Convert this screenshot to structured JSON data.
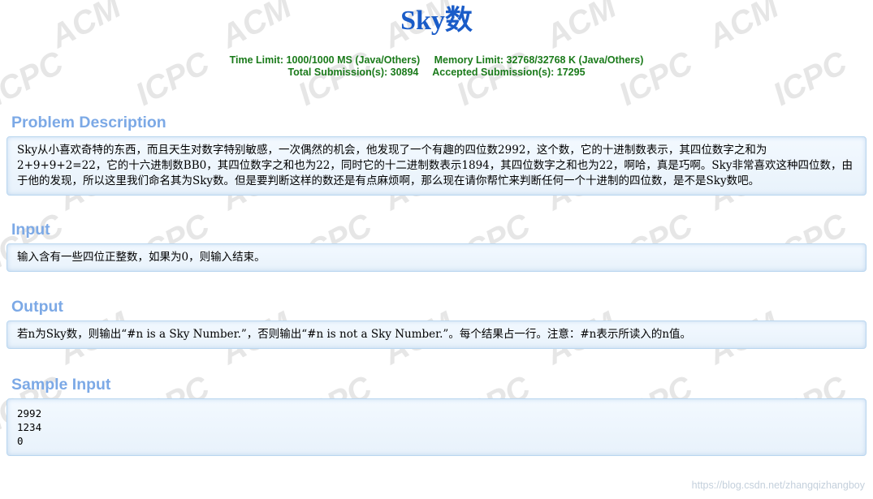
{
  "title": "Sky数",
  "limits": {
    "time": "Time Limit: 1000/1000 MS (Java/Others)",
    "memory": "Memory Limit: 32768/32768 K (Java/Others)",
    "total": "Total Submission(s): 30894",
    "accepted": "Accepted Submission(s): 17295"
  },
  "sections": {
    "description": {
      "title": "Problem Description",
      "body": "Sky从小喜欢奇特的东西，而且天生对数字特别敏感，一次偶然的机会，他发现了一个有趣的四位数2992，这个数，它的十进制数表示，其四位数字之和为2+9+9+2=22，它的十六进制数BB0，其四位数字之和也为22，同时它的十二进制数表示1894，其四位数字之和也为22，啊哈，真是巧啊。Sky非常喜欢这种四位数，由于他的发现，所以这里我们命名其为Sky数。但是要判断这样的数还是有点麻烦啊，那么现在请你帮忙来判断任何一个十进制的四位数，是不是Sky数吧。"
    },
    "input": {
      "title": "Input",
      "body": "输入含有一些四位正整数，如果为0，则输入结束。"
    },
    "output": {
      "title": "Output",
      "body": "若n为Sky数，则输出“#n is a Sky Number.”，否则输出“#n is not a Sky Number.”。每个结果占一行。注意：#n表示所读入的n值。"
    },
    "sample_input": {
      "title": "Sample Input",
      "body": "2992\n1234\n0"
    }
  },
  "watermark": {
    "text_acm": "ACM",
    "text_icpc": "ICPC"
  },
  "credit": "https://blog.csdn.net/zhangqizhangboy",
  "colors": {
    "title": "#1a5cc8",
    "limits": "#1a7a1a",
    "section": "#7ca9e6",
    "panel_border": "#b9d6ef"
  }
}
